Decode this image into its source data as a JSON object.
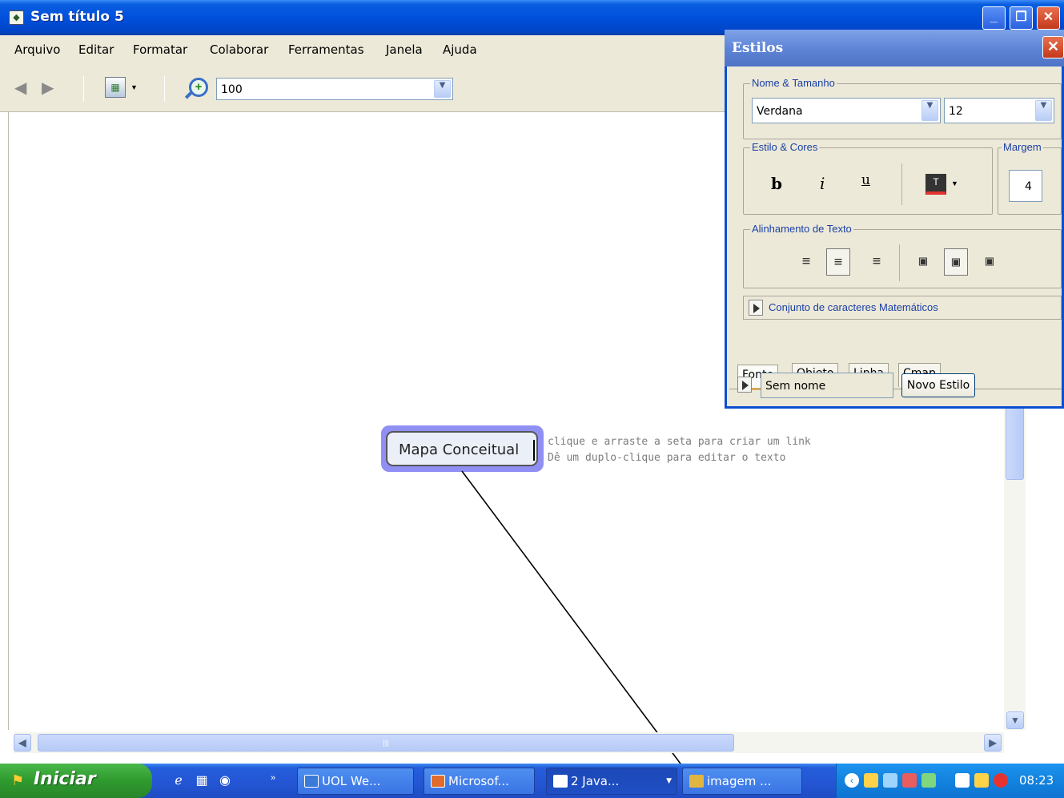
{
  "window": {
    "title": "Sem título 5"
  },
  "menu": [
    "Arquivo",
    "Editar",
    "Formatar",
    "Colaborar",
    "Ferramentas",
    "Janela",
    "Ajuda"
  ],
  "toolbar": {
    "zoom_value": "100"
  },
  "canvas": {
    "concept_text": "Mapa Conceitual",
    "hint_line1": "clique e arraste a seta para criar um link",
    "hint_line2": "Dê um duplo-clique para editar o texto"
  },
  "styles_panel": {
    "title": "Estilos",
    "group_font": "Nome & Tamanho",
    "font_name": "Verdana",
    "font_size": "12",
    "group_style": "Estilo & Cores",
    "bold": "b",
    "italic": "i",
    "underline": "u",
    "group_margin": "Margem",
    "margin_value": "4",
    "group_align": "Alinhamento de Texto",
    "math_charset": "Conjunto de caracteres Matemáticos",
    "tabs": [
      "Fonte",
      "Objeto",
      "Linha",
      "Cmap"
    ],
    "style_name": "Sem nome",
    "new_style_button": "Novo Estilo"
  },
  "taskbar": {
    "start_label": "Iniciar",
    "tasks": [
      "UOL We...",
      "Microsof...",
      "2 Java...",
      "imagem ..."
    ],
    "clock": "08:23"
  },
  "colors": {
    "titlebar": "#0050dc",
    "concept_highlight": "#8f8ff4",
    "panel_bg": "#ece9d8",
    "start_green": "#2e9a2e"
  }
}
